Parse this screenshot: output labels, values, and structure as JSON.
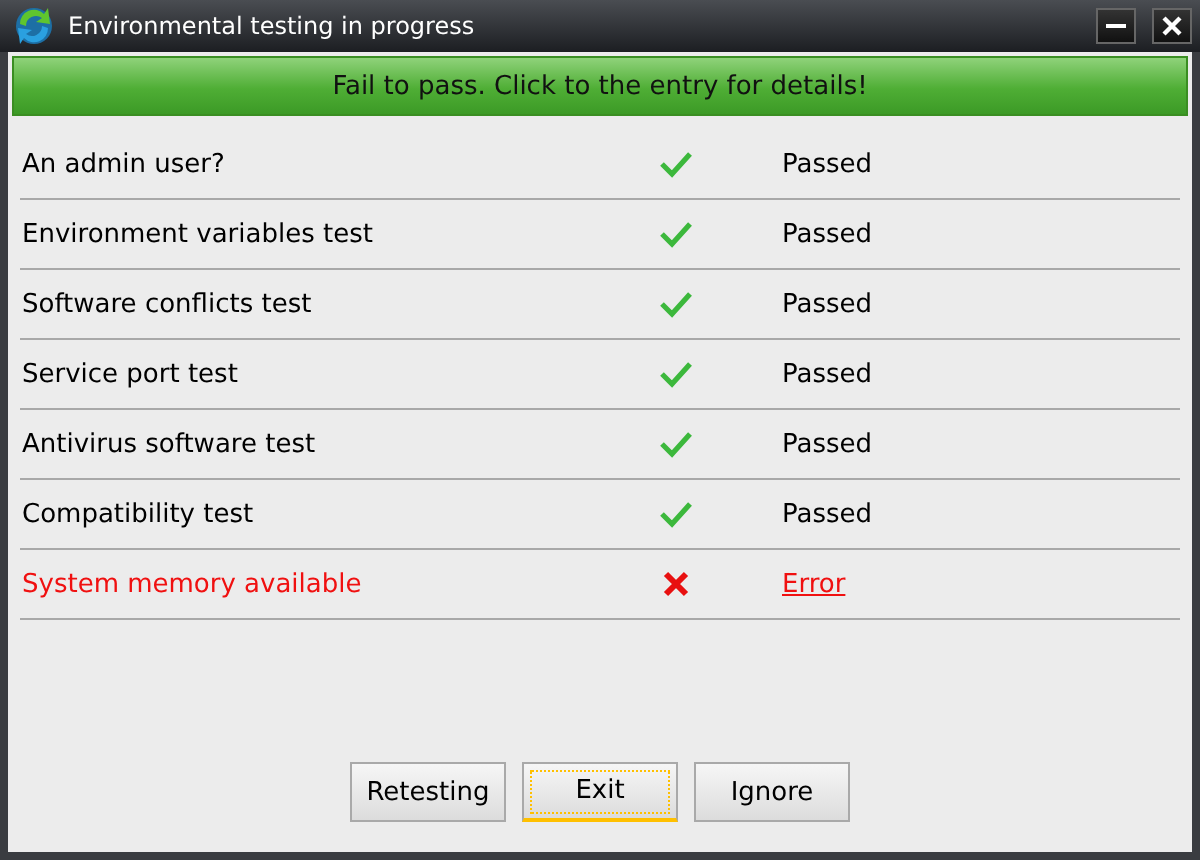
{
  "window": {
    "title": "Environmental testing in progress"
  },
  "banner": "Fail to pass. Click to the entry for details!",
  "tests": [
    {
      "name": "An admin user?",
      "passed": true,
      "status": "Passed"
    },
    {
      "name": "Environment variables test",
      "passed": true,
      "status": "Passed"
    },
    {
      "name": "Software conflicts test",
      "passed": true,
      "status": "Passed"
    },
    {
      "name": "Service port test",
      "passed": true,
      "status": "Passed"
    },
    {
      "name": "Antivirus software test",
      "passed": true,
      "status": "Passed"
    },
    {
      "name": "Compatibility test",
      "passed": true,
      "status": "Passed"
    },
    {
      "name": "System memory available",
      "passed": false,
      "status": "Error"
    }
  ],
  "buttons": [
    {
      "label": "Retesting",
      "focused": false
    },
    {
      "label": "Exit",
      "focused": true
    },
    {
      "label": "Ignore",
      "focused": false
    }
  ]
}
